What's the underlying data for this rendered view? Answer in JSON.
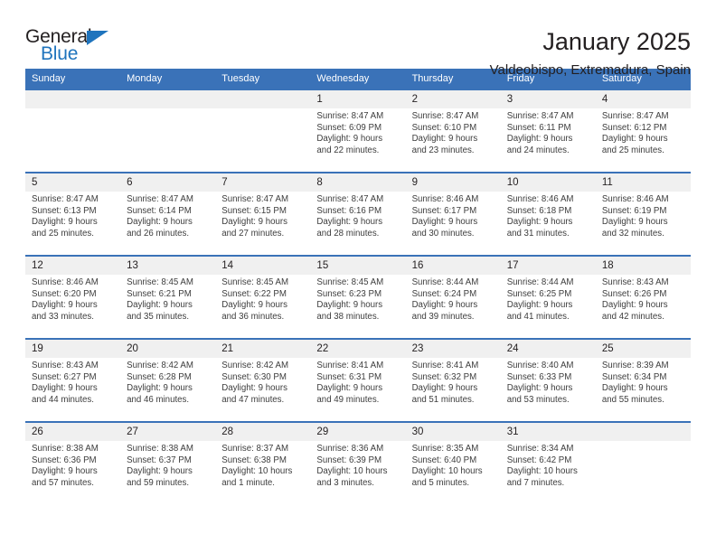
{
  "brand": {
    "name_top": "General",
    "name_bottom": "Blue",
    "triangle_icon": "triangle-icon",
    "accent_color": "#1f74bd"
  },
  "header": {
    "title": "January 2025",
    "location": "Valdeobispo, Extremadura, Spain"
  },
  "theme": {
    "header_bar_color": "#3a72b8",
    "day_number_band_color": "#f0f0f0",
    "text_color": "#231f20"
  },
  "calendar": {
    "weekday_headers": [
      "Sunday",
      "Monday",
      "Tuesday",
      "Wednesday",
      "Thursday",
      "Friday",
      "Saturday"
    ],
    "weeks": [
      [
        {
          "day": "",
          "lines": []
        },
        {
          "day": "",
          "lines": []
        },
        {
          "day": "",
          "lines": []
        },
        {
          "day": "1",
          "lines": [
            "Sunrise: 8:47 AM",
            "Sunset: 6:09 PM",
            "Daylight: 9 hours",
            "and 22 minutes."
          ]
        },
        {
          "day": "2",
          "lines": [
            "Sunrise: 8:47 AM",
            "Sunset: 6:10 PM",
            "Daylight: 9 hours",
            "and 23 minutes."
          ]
        },
        {
          "day": "3",
          "lines": [
            "Sunrise: 8:47 AM",
            "Sunset: 6:11 PM",
            "Daylight: 9 hours",
            "and 24 minutes."
          ]
        },
        {
          "day": "4",
          "lines": [
            "Sunrise: 8:47 AM",
            "Sunset: 6:12 PM",
            "Daylight: 9 hours",
            "and 25 minutes."
          ]
        }
      ],
      [
        {
          "day": "5",
          "lines": [
            "Sunrise: 8:47 AM",
            "Sunset: 6:13 PM",
            "Daylight: 9 hours",
            "and 25 minutes."
          ]
        },
        {
          "day": "6",
          "lines": [
            "Sunrise: 8:47 AM",
            "Sunset: 6:14 PM",
            "Daylight: 9 hours",
            "and 26 minutes."
          ]
        },
        {
          "day": "7",
          "lines": [
            "Sunrise: 8:47 AM",
            "Sunset: 6:15 PM",
            "Daylight: 9 hours",
            "and 27 minutes."
          ]
        },
        {
          "day": "8",
          "lines": [
            "Sunrise: 8:47 AM",
            "Sunset: 6:16 PM",
            "Daylight: 9 hours",
            "and 28 minutes."
          ]
        },
        {
          "day": "9",
          "lines": [
            "Sunrise: 8:46 AM",
            "Sunset: 6:17 PM",
            "Daylight: 9 hours",
            "and 30 minutes."
          ]
        },
        {
          "day": "10",
          "lines": [
            "Sunrise: 8:46 AM",
            "Sunset: 6:18 PM",
            "Daylight: 9 hours",
            "and 31 minutes."
          ]
        },
        {
          "day": "11",
          "lines": [
            "Sunrise: 8:46 AM",
            "Sunset: 6:19 PM",
            "Daylight: 9 hours",
            "and 32 minutes."
          ]
        }
      ],
      [
        {
          "day": "12",
          "lines": [
            "Sunrise: 8:46 AM",
            "Sunset: 6:20 PM",
            "Daylight: 9 hours",
            "and 33 minutes."
          ]
        },
        {
          "day": "13",
          "lines": [
            "Sunrise: 8:45 AM",
            "Sunset: 6:21 PM",
            "Daylight: 9 hours",
            "and 35 minutes."
          ]
        },
        {
          "day": "14",
          "lines": [
            "Sunrise: 8:45 AM",
            "Sunset: 6:22 PM",
            "Daylight: 9 hours",
            "and 36 minutes."
          ]
        },
        {
          "day": "15",
          "lines": [
            "Sunrise: 8:45 AM",
            "Sunset: 6:23 PM",
            "Daylight: 9 hours",
            "and 38 minutes."
          ]
        },
        {
          "day": "16",
          "lines": [
            "Sunrise: 8:44 AM",
            "Sunset: 6:24 PM",
            "Daylight: 9 hours",
            "and 39 minutes."
          ]
        },
        {
          "day": "17",
          "lines": [
            "Sunrise: 8:44 AM",
            "Sunset: 6:25 PM",
            "Daylight: 9 hours",
            "and 41 minutes."
          ]
        },
        {
          "day": "18",
          "lines": [
            "Sunrise: 8:43 AM",
            "Sunset: 6:26 PM",
            "Daylight: 9 hours",
            "and 42 minutes."
          ]
        }
      ],
      [
        {
          "day": "19",
          "lines": [
            "Sunrise: 8:43 AM",
            "Sunset: 6:27 PM",
            "Daylight: 9 hours",
            "and 44 minutes."
          ]
        },
        {
          "day": "20",
          "lines": [
            "Sunrise: 8:42 AM",
            "Sunset: 6:28 PM",
            "Daylight: 9 hours",
            "and 46 minutes."
          ]
        },
        {
          "day": "21",
          "lines": [
            "Sunrise: 8:42 AM",
            "Sunset: 6:30 PM",
            "Daylight: 9 hours",
            "and 47 minutes."
          ]
        },
        {
          "day": "22",
          "lines": [
            "Sunrise: 8:41 AM",
            "Sunset: 6:31 PM",
            "Daylight: 9 hours",
            "and 49 minutes."
          ]
        },
        {
          "day": "23",
          "lines": [
            "Sunrise: 8:41 AM",
            "Sunset: 6:32 PM",
            "Daylight: 9 hours",
            "and 51 minutes."
          ]
        },
        {
          "day": "24",
          "lines": [
            "Sunrise: 8:40 AM",
            "Sunset: 6:33 PM",
            "Daylight: 9 hours",
            "and 53 minutes."
          ]
        },
        {
          "day": "25",
          "lines": [
            "Sunrise: 8:39 AM",
            "Sunset: 6:34 PM",
            "Daylight: 9 hours",
            "and 55 minutes."
          ]
        }
      ],
      [
        {
          "day": "26",
          "lines": [
            "Sunrise: 8:38 AM",
            "Sunset: 6:36 PM",
            "Daylight: 9 hours",
            "and 57 minutes."
          ]
        },
        {
          "day": "27",
          "lines": [
            "Sunrise: 8:38 AM",
            "Sunset: 6:37 PM",
            "Daylight: 9 hours",
            "and 59 minutes."
          ]
        },
        {
          "day": "28",
          "lines": [
            "Sunrise: 8:37 AM",
            "Sunset: 6:38 PM",
            "Daylight: 10 hours",
            "and 1 minute."
          ]
        },
        {
          "day": "29",
          "lines": [
            "Sunrise: 8:36 AM",
            "Sunset: 6:39 PM",
            "Daylight: 10 hours",
            "and 3 minutes."
          ]
        },
        {
          "day": "30",
          "lines": [
            "Sunrise: 8:35 AM",
            "Sunset: 6:40 PM",
            "Daylight: 10 hours",
            "and 5 minutes."
          ]
        },
        {
          "day": "31",
          "lines": [
            "Sunrise: 8:34 AM",
            "Sunset: 6:42 PM",
            "Daylight: 10 hours",
            "and 7 minutes."
          ]
        },
        {
          "day": "",
          "lines": []
        }
      ]
    ]
  }
}
